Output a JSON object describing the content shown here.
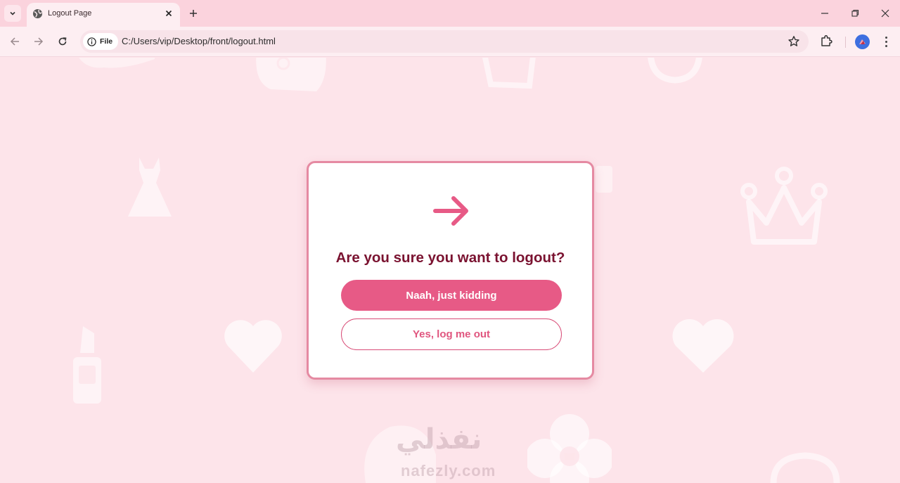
{
  "browser": {
    "tab_title": "Logout Page",
    "address_chip": "File",
    "url": "C:/Users/vip/Desktop/front/logout.html"
  },
  "icons": {
    "tab_list": "chevron-down-icon",
    "favicon": "globe-icon",
    "close_tab": "close-icon",
    "new_tab": "plus-icon",
    "minimize": "minimize-icon",
    "restore": "restore-icon",
    "close_window": "close-icon",
    "back": "arrow-left-icon",
    "forward": "arrow-right-icon",
    "reload": "reload-icon",
    "info": "info-icon",
    "bookmark": "star-icon",
    "extensions": "puzzle-icon",
    "menu": "more-vertical-icon",
    "logout": "arrow-right-icon"
  },
  "dialog": {
    "title": "Are you sure you want to logout?",
    "cancel_label": "Naah, just kidding",
    "confirm_label": "Yes, log me out"
  },
  "watermark": {
    "arabic": "نفذلي",
    "latin": "nafezly.com"
  },
  "colors": {
    "page_background": "#fde4ea",
    "accent": "#e75a86",
    "title": "#7a1230",
    "card_border": "#e58aa2"
  }
}
